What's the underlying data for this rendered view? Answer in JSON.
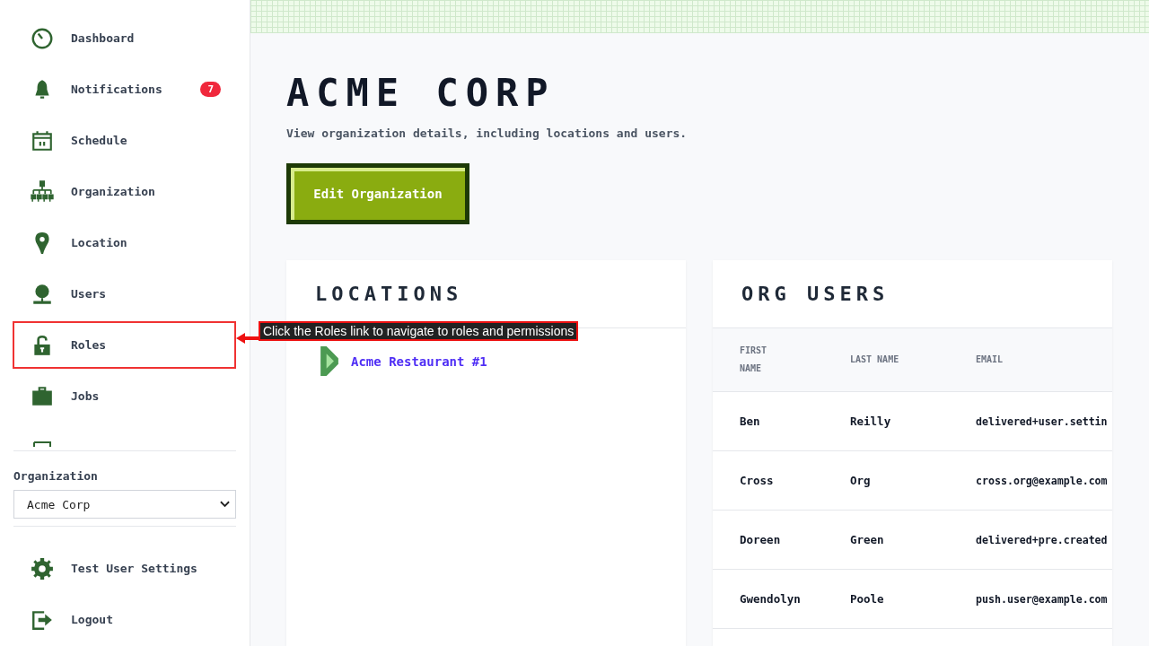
{
  "sidebar": {
    "items": [
      {
        "label": "Dashboard",
        "highlighted": false
      },
      {
        "label": "Notifications",
        "badge": "7",
        "highlighted": false
      },
      {
        "label": "Schedule",
        "highlighted": false
      },
      {
        "label": "Organization",
        "highlighted": false
      },
      {
        "label": "Location",
        "highlighted": false
      },
      {
        "label": "Users",
        "highlighted": false
      },
      {
        "label": "Roles",
        "highlighted": true
      },
      {
        "label": "Jobs",
        "highlighted": false
      }
    ],
    "org_label": "Organization",
    "org_select": {
      "value": "Acme Corp"
    },
    "footer_items": [
      {
        "label": "Test User Settings"
      },
      {
        "label": "Logout"
      }
    ]
  },
  "annotation": {
    "text": "Click the Roles link to navigate to roles and permissions"
  },
  "page": {
    "title": "ACME CORP",
    "subtitle": "View organization details, including locations and users.",
    "button": "Edit Organization"
  },
  "locations": {
    "title": "LOCATIONS",
    "items": [
      {
        "label": "Acme Restaurant #1"
      }
    ]
  },
  "org_users": {
    "title": "ORG USERS",
    "columns": [
      "FIRST NAME",
      "LAST NAME",
      "EMAIL"
    ],
    "rows": [
      [
        "Ben",
        "Reilly",
        "delivered+user.settin"
      ],
      [
        "Cross",
        "Org",
        "cross.org@example.com"
      ],
      [
        "Doreen",
        "Green",
        "delivered+pre.created"
      ],
      [
        "Gwendolyn",
        "Poole",
        "push.user@example.com"
      ]
    ]
  }
}
